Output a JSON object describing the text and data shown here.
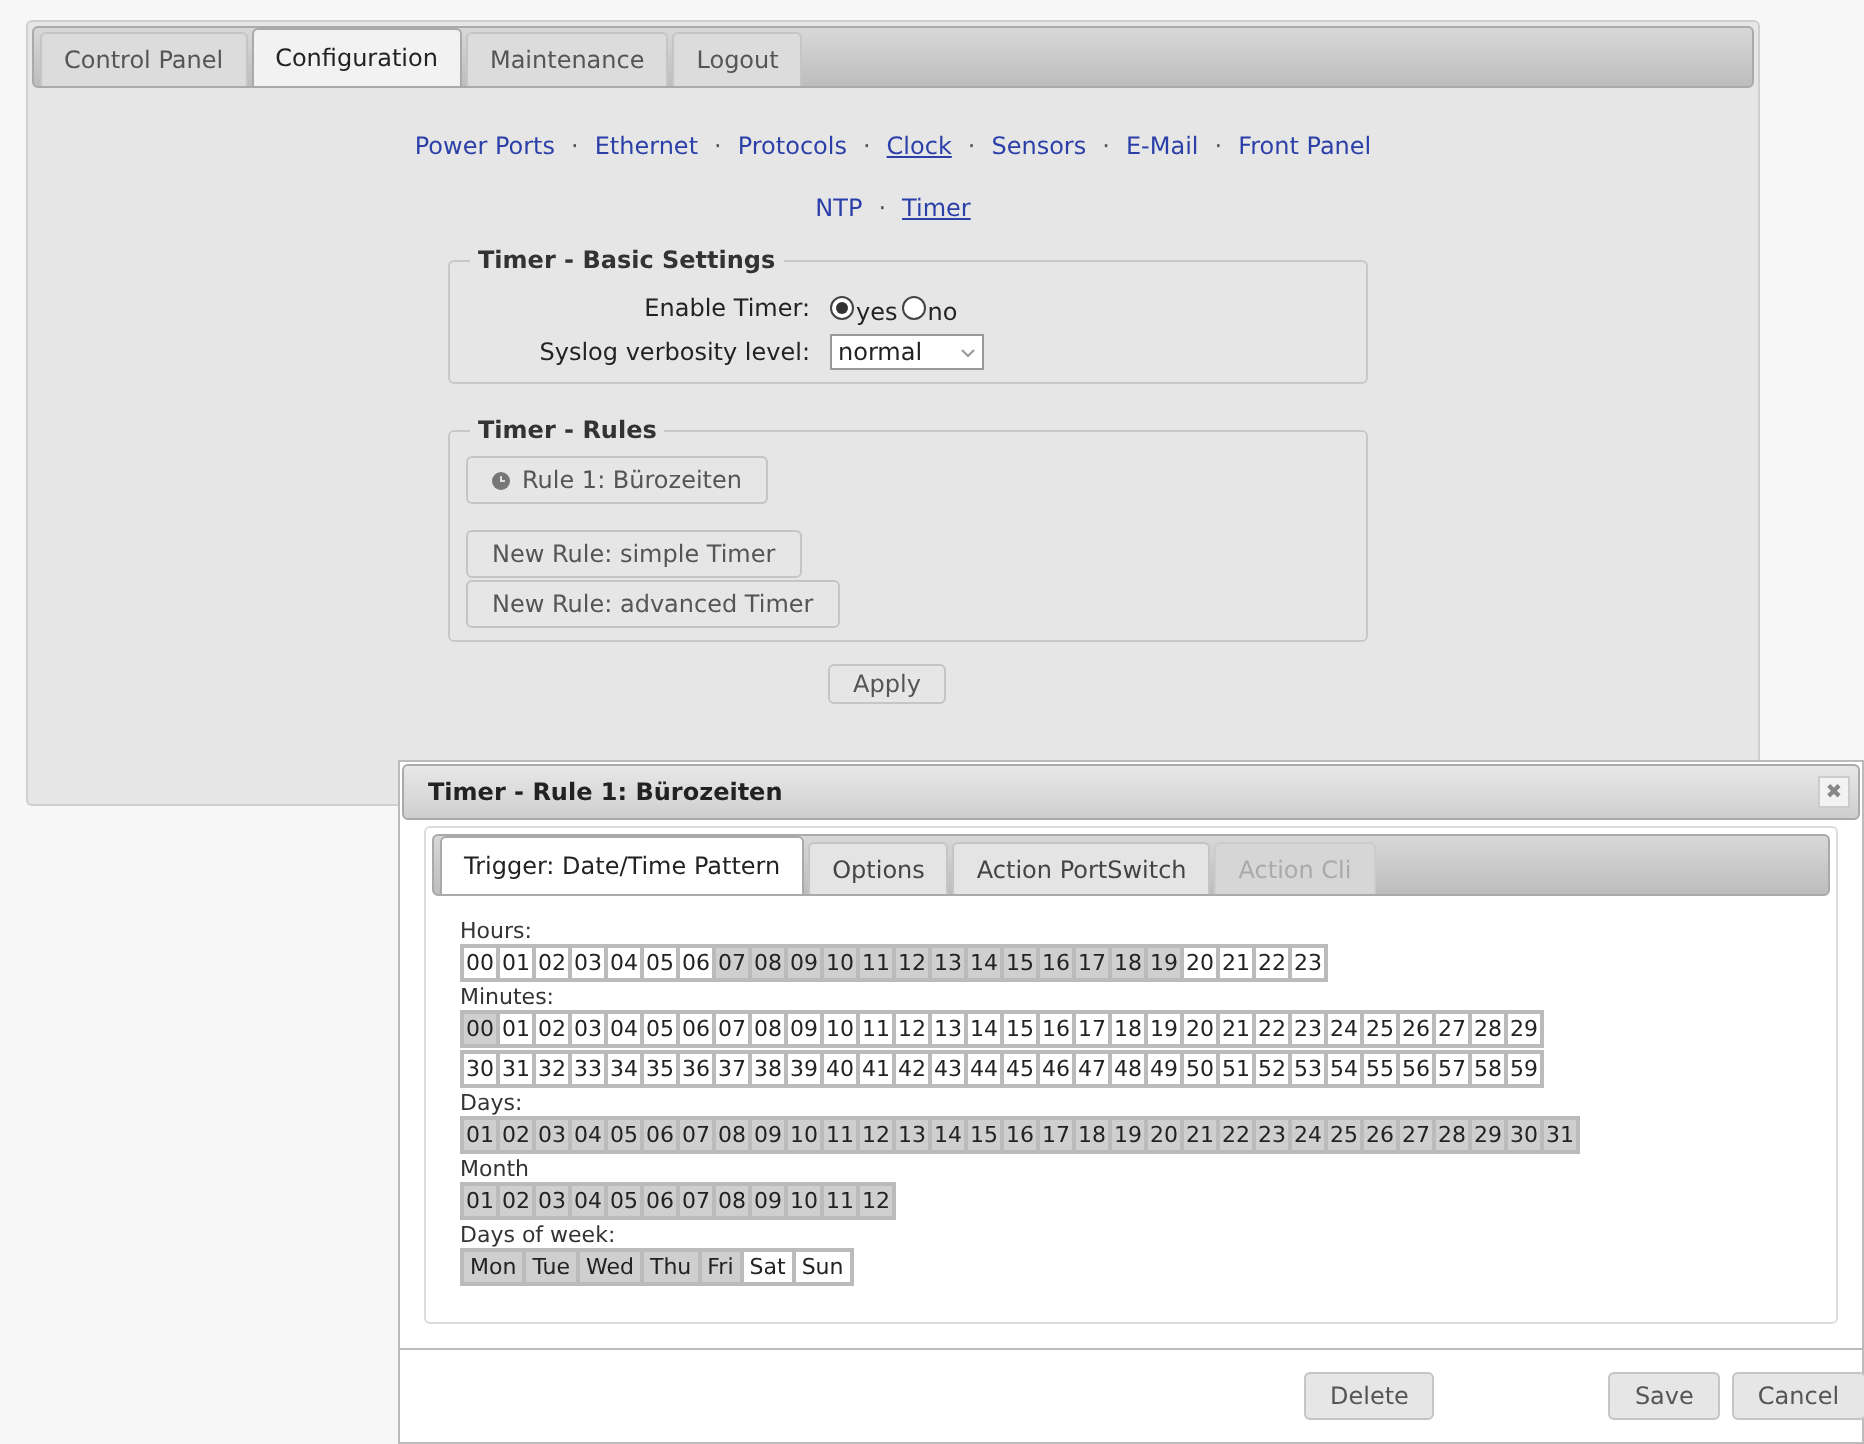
{
  "main_tabs": [
    {
      "label": "Control Panel",
      "selected": false
    },
    {
      "label": "Configuration",
      "selected": true
    },
    {
      "label": "Maintenance",
      "selected": false
    },
    {
      "label": "Logout",
      "selected": false
    }
  ],
  "nav_links": [
    {
      "label": "Power Ports",
      "selected": false
    },
    {
      "label": "Ethernet",
      "selected": false
    },
    {
      "label": "Protocols",
      "selected": false
    },
    {
      "label": "Clock",
      "selected": true
    },
    {
      "label": "Sensors",
      "selected": false
    },
    {
      "label": "E-Mail",
      "selected": false
    },
    {
      "label": "Front Panel",
      "selected": false
    }
  ],
  "sub_links": [
    {
      "label": "NTP",
      "selected": false
    },
    {
      "label": "Timer",
      "selected": true
    }
  ],
  "nav_separator": "·",
  "basic_settings": {
    "legend": "Timer - Basic Settings",
    "enable_label": "Enable Timer:",
    "enable_options": [
      {
        "label": "yes",
        "selected": true
      },
      {
        "label": "no",
        "selected": false
      }
    ],
    "syslog_label": "Syslog verbosity level:",
    "syslog_value": "normal"
  },
  "rules": {
    "legend": "Timer - Rules",
    "rule_buttons": [
      "Rule 1: Bürozeiten"
    ],
    "new_buttons": [
      "New Rule: simple Timer",
      "New Rule: advanced Timer"
    ]
  },
  "apply_button": "Apply",
  "dialog": {
    "title": "Timer - Rule 1: Bürozeiten",
    "close": "✖",
    "tabs": [
      {
        "label": "Trigger: Date/Time Pattern",
        "selected": true,
        "disabled": false
      },
      {
        "label": "Options",
        "selected": false,
        "disabled": false
      },
      {
        "label": "Action PortSwitch",
        "selected": false,
        "disabled": false
      },
      {
        "label": "Action Cli",
        "selected": false,
        "disabled": true
      }
    ],
    "groups": [
      {
        "label": "Hours:",
        "rows": [
          [
            "00",
            "01",
            "02",
            "03",
            "04",
            "05",
            "06",
            "07",
            "08",
            "09",
            "10",
            "11",
            "12",
            "13",
            "14",
            "15",
            "16",
            "17",
            "18",
            "19",
            "20",
            "21",
            "22",
            "23"
          ]
        ],
        "selected": [
          [
            false,
            false,
            false,
            false,
            false,
            false,
            false,
            true,
            true,
            true,
            true,
            true,
            true,
            true,
            true,
            true,
            true,
            true,
            true,
            true,
            false,
            false,
            false,
            false
          ]
        ]
      },
      {
        "label": "Minutes:",
        "rows": [
          [
            "00",
            "01",
            "02",
            "03",
            "04",
            "05",
            "06",
            "07",
            "08",
            "09",
            "10",
            "11",
            "12",
            "13",
            "14",
            "15",
            "16",
            "17",
            "18",
            "19",
            "20",
            "21",
            "22",
            "23",
            "24",
            "25",
            "26",
            "27",
            "28",
            "29"
          ],
          [
            "30",
            "31",
            "32",
            "33",
            "34",
            "35",
            "36",
            "37",
            "38",
            "39",
            "40",
            "41",
            "42",
            "43",
            "44",
            "45",
            "46",
            "47",
            "48",
            "49",
            "50",
            "51",
            "52",
            "53",
            "54",
            "55",
            "56",
            "57",
            "58",
            "59"
          ]
        ],
        "selected": [
          [
            true,
            false,
            false,
            false,
            false,
            false,
            false,
            false,
            false,
            false,
            false,
            false,
            false,
            false,
            false,
            false,
            false,
            false,
            false,
            false,
            false,
            false,
            false,
            false,
            false,
            false,
            false,
            false,
            false,
            false
          ],
          [
            false,
            false,
            false,
            false,
            false,
            false,
            false,
            false,
            false,
            false,
            false,
            false,
            false,
            false,
            false,
            false,
            false,
            false,
            false,
            false,
            false,
            false,
            false,
            false,
            false,
            false,
            false,
            false,
            false,
            false
          ]
        ]
      },
      {
        "label": "Days:",
        "rows": [
          [
            "01",
            "02",
            "03",
            "04",
            "05",
            "06",
            "07",
            "08",
            "09",
            "10",
            "11",
            "12",
            "13",
            "14",
            "15",
            "16",
            "17",
            "18",
            "19",
            "20",
            "21",
            "22",
            "23",
            "24",
            "25",
            "26",
            "27",
            "28",
            "29",
            "30",
            "31"
          ]
        ],
        "selected": [
          [
            true,
            true,
            true,
            true,
            true,
            true,
            true,
            true,
            true,
            true,
            true,
            true,
            true,
            true,
            true,
            true,
            true,
            true,
            true,
            true,
            true,
            true,
            true,
            true,
            true,
            true,
            true,
            true,
            true,
            true,
            true
          ]
        ]
      },
      {
        "label": "Month",
        "rows": [
          [
            "01",
            "02",
            "03",
            "04",
            "05",
            "06",
            "07",
            "08",
            "09",
            "10",
            "11",
            "12"
          ]
        ],
        "selected": [
          [
            true,
            true,
            true,
            true,
            true,
            true,
            true,
            true,
            true,
            true,
            true,
            true
          ]
        ]
      },
      {
        "label": "Days of week:",
        "rows": [
          [
            "Mon",
            "Tue",
            "Wed",
            "Thu",
            "Fri",
            "Sat",
            "Sun"
          ]
        ],
        "selected": [
          [
            true,
            true,
            true,
            true,
            true,
            false,
            false
          ]
        ]
      }
    ],
    "delete_button": "Delete",
    "save_button": "Save",
    "cancel_button": "Cancel"
  }
}
